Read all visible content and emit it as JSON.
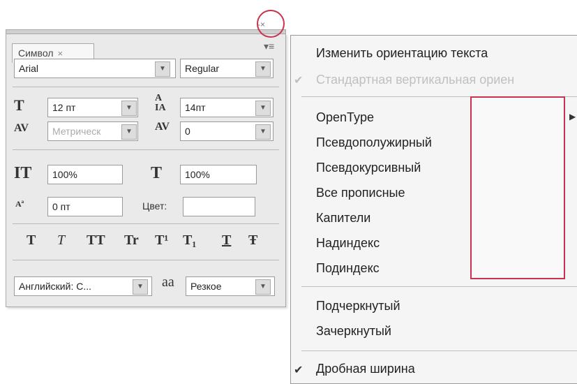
{
  "panel": {
    "tab_label": "Символ",
    "tab_close": "×",
    "menu_icon": "≡",
    "collapse_icon": "-×",
    "font_family": "Arial",
    "font_style": "Regular",
    "font_size": "12 пт",
    "leading": "14пт",
    "kerning": "Метрическ",
    "tracking": "0",
    "vertical_scale": "100%",
    "horizontal_scale": "100%",
    "baseline_shift": "0 пт",
    "color_label": "Цвет:",
    "color_value": "",
    "language": "Английский: С...",
    "antialias": "Резкое",
    "style_buttons": [
      "T",
      "T",
      "TT",
      "Tr",
      "T¹",
      "T₁",
      "T",
      "Ŧ"
    ],
    "dropdown_arrow": "▼"
  },
  "menu": {
    "items": [
      {
        "label": "Изменить ориентацию текста",
        "checked": false,
        "disabled": false
      },
      {
        "label": "Стандартная вертикальная ориен",
        "checked": true,
        "disabled": true
      },
      {
        "label": "OpenType",
        "checked": false,
        "disabled": false
      },
      {
        "label": "Псевдополужирный",
        "checked": false,
        "disabled": false
      },
      {
        "label": "Псевдокурсивный",
        "checked": false,
        "disabled": false
      },
      {
        "label": "Все прописные",
        "checked": false,
        "disabled": false
      },
      {
        "label": "Капители",
        "checked": false,
        "disabled": false
      },
      {
        "label": "Надиндекс",
        "checked": false,
        "disabled": false
      },
      {
        "label": "Подиндекс",
        "checked": false,
        "disabled": false
      },
      {
        "label": "Подчеркнутый",
        "checked": false,
        "disabled": false
      },
      {
        "label": "Зачеркнутый",
        "checked": false,
        "disabled": false
      },
      {
        "label": "Дробная ширина",
        "checked": true,
        "disabled": false
      }
    ],
    "check_mark": "✔",
    "submenu_arrow": "▶"
  },
  "colors": {
    "highlight": "#c8334f"
  }
}
